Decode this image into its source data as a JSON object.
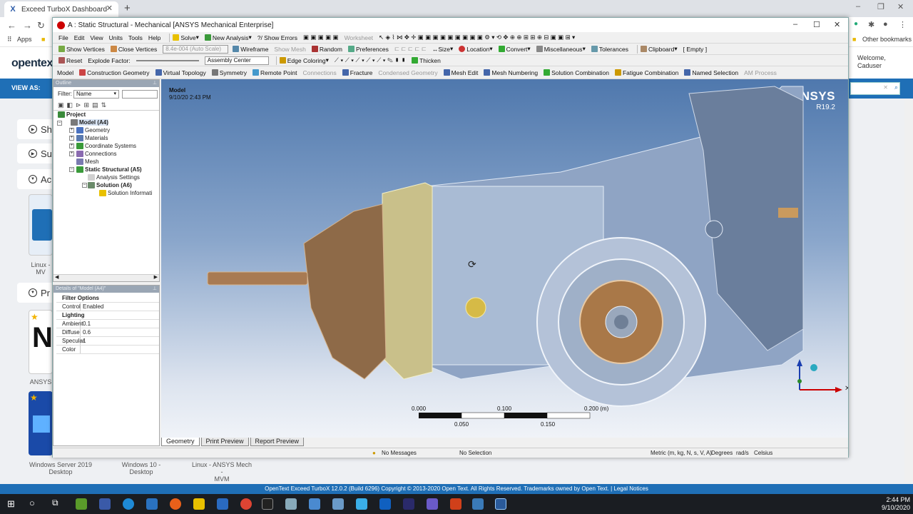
{
  "browser": {
    "tab_title": "Exceed TurboX Dashboard",
    "tab_favicon": "X",
    "new_tab": "+",
    "close_tab": "✕",
    "bookmarks": {
      "apps": "Apps",
      "other": "Other bookmarks"
    }
  },
  "site": {
    "logo": "opentex",
    "welcome_line1": "Welcome,",
    "welcome_line2": "Caduser",
    "view_as": "VIEW AS:",
    "sections": [
      {
        "label": "Sh"
      },
      {
        "label": "Su"
      },
      {
        "label": "Ac"
      },
      {
        "label": "Pr"
      }
    ],
    "tile_labels": [
      {
        "line1": "Linux -",
        "line2": "MV"
      },
      {
        "line1": "ANSYS",
        "line2": ""
      }
    ],
    "desktops": [
      {
        "line1": "Windows Server 2019",
        "line2": "Desktop"
      },
      {
        "line1": "Windows 10 - Desktop",
        "line2": ""
      },
      {
        "line1": "Linux - ANSYS Mech -",
        "line2": "MVM"
      }
    ],
    "footer": "OpenText Exceed TurboX 12.0.2 (Build 6296) Copyright © 2013-2020 Open Text. All Rights Reserved. Trademarks owned by Open Text. | Legal Notices"
  },
  "ansys": {
    "title": "A : Static Structural - Mechanical [ANSYS Mechanical Enterprise]",
    "menu": [
      "File",
      "Edit",
      "View",
      "Units",
      "Tools",
      "Help"
    ],
    "toolbar1": {
      "solve": "Solve",
      "new_analysis": "New Analysis",
      "show_errors": "?/ Show Errors",
      "worksheet": "Worksheet"
    },
    "toolbar2": {
      "show_vertices": "Show Vertices",
      "close_vertices": "Close Vertices",
      "auto_scale": "8.4e-004 (Auto Scale)",
      "wireframe": "Wireframe",
      "show_mesh": "Show Mesh",
      "random": "Random",
      "preferences": "Preferences",
      "size": "Size",
      "location": "Location",
      "convert": "Convert",
      "miscellaneous": "Miscellaneous",
      "tolerances": "Tolerances",
      "clipboard": "Clipboard",
      "empty": "[ Empty ]"
    },
    "toolbar3": {
      "reset": "Reset",
      "explode_factor": "Explode Factor:",
      "assembly_center": "Assembly Center",
      "edge_coloring": "Edge Coloring",
      "thicken": "Thicken"
    },
    "context_bar": [
      "Model",
      "Construction Geometry",
      "Virtual Topology",
      "Symmetry",
      "Remote Point",
      "Connections",
      "Fracture",
      "Condensed Geometry",
      "Mesh Edit",
      "Mesh Numbering",
      "Solution Combination",
      "Fatigue Combination",
      "Named Selection",
      "AM Process"
    ],
    "outline": {
      "header": "Outline",
      "filter_label": "Filter:",
      "filter_value": "Name",
      "tree": [
        {
          "label": "Project",
          "level": 0,
          "bold": true
        },
        {
          "label": "Model (A4)",
          "level": 1,
          "bold": true
        },
        {
          "label": "Geometry",
          "level": 2,
          "bold": false
        },
        {
          "label": "Materials",
          "level": 2,
          "bold": false
        },
        {
          "label": "Coordinate Systems",
          "level": 2,
          "bold": false
        },
        {
          "label": "Connections",
          "level": 2,
          "bold": false
        },
        {
          "label": "Mesh",
          "level": 2,
          "bold": false
        },
        {
          "label": "Static Structural (A5)",
          "level": 2,
          "bold": true
        },
        {
          "label": "Analysis Settings",
          "level": 3,
          "bold": false
        },
        {
          "label": "Solution (A6)",
          "level": 3,
          "bold": true
        },
        {
          "label": "Solution Informati",
          "level": 4,
          "bold": false
        }
      ]
    },
    "details": {
      "header": "Details of \"Model (A4)\"",
      "filter_group": "Filter Options",
      "control_key": "Control",
      "control_val": "Enabled",
      "lighting_group": "Lighting",
      "ambient_key": "Ambient",
      "ambient_val": "0.1",
      "diffuse_key": "Diffuse",
      "diffuse_val": "0.6",
      "specular_key": "Specular",
      "specular_val": "1",
      "color_key": "Color",
      "color_val": ""
    },
    "viewport": {
      "title": "Model",
      "date": "9/10/20 2:43 PM",
      "logo": "ANSYS",
      "version": "R19.2",
      "scale_top": [
        "0.000",
        "0.100",
        "0.200 (m)"
      ],
      "scale_bottom": [
        "0.050",
        "0.150"
      ]
    },
    "view_tabs": [
      "Geometry",
      "Print Preview",
      "Report Preview"
    ],
    "status": {
      "messages": "No Messages",
      "selection": "No Selection",
      "units": "Metric (m, kg, N, s, V, A)",
      "deg": "Degrees",
      "rad": "rad/s",
      "temp": "Celsius"
    }
  },
  "taskbar": {
    "time": "2:44 PM",
    "date": "9/10/2020"
  }
}
